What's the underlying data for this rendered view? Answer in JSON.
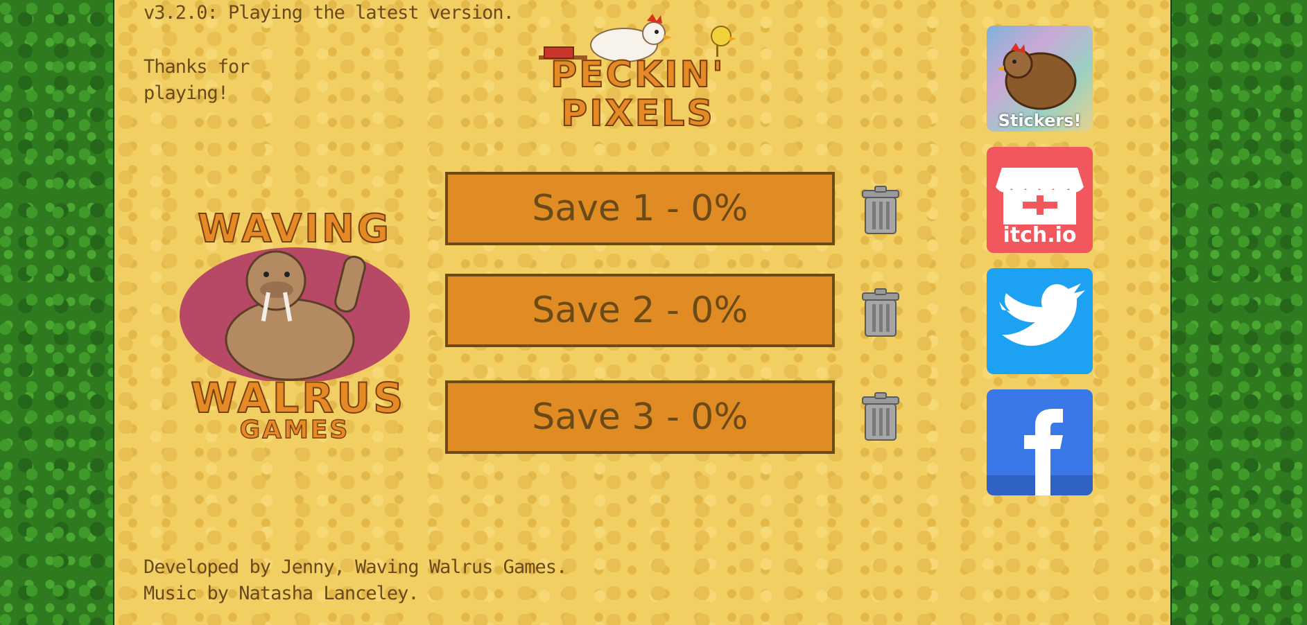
{
  "header": {
    "version_text": "v3.2.0: Playing the latest version.",
    "thanks_text": "Thanks for playing!"
  },
  "game_logo": {
    "line1": "PECKIN'",
    "line2": "PIXELS"
  },
  "studio_logo": {
    "line1": "WAVING",
    "line2": "WALRUS",
    "line3": "GAMES"
  },
  "saves": [
    {
      "label": "Save 1 - 0%"
    },
    {
      "label": "Save 2 - 0%"
    },
    {
      "label": "Save 3 - 0%"
    }
  ],
  "social": {
    "stickers_label": "Stickers!",
    "itch_label": "itch.io"
  },
  "credits": {
    "line1": "Developed by Jenny, Waving Walrus Games.",
    "line2": "Music by Natasha Lanceley."
  },
  "colors": {
    "panel": "#f2cf63",
    "grass": "#2f7a1f",
    "button": "#e08b23",
    "button_border": "#6b4a16",
    "itch": "#f1575c",
    "twitter": "#1da1f2",
    "facebook": "#3b78e7"
  }
}
